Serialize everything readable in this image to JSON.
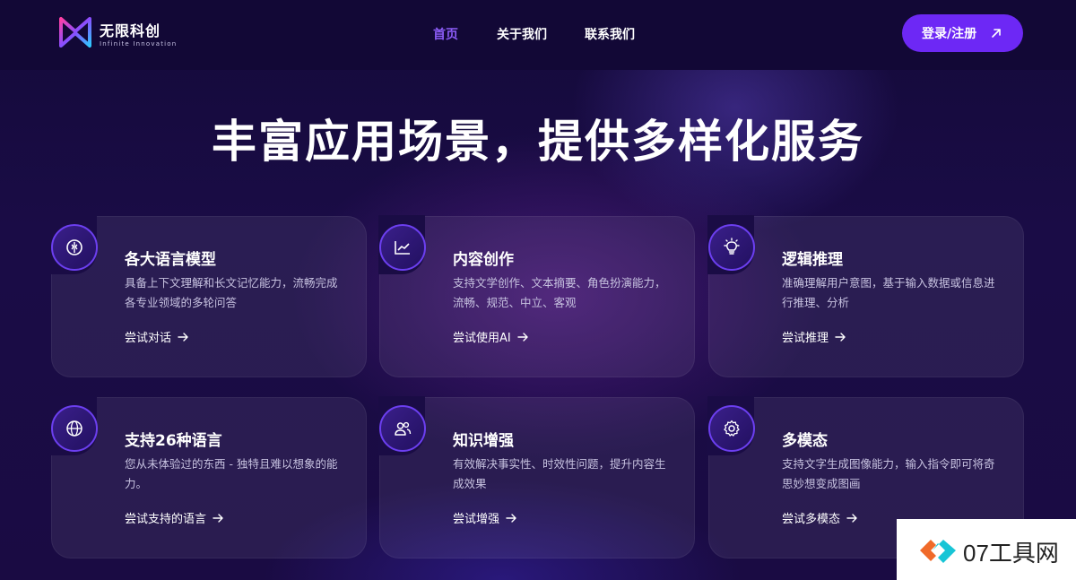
{
  "header": {
    "logo_name": "无限科创",
    "logo_sub": "Infinite Innovation",
    "nav": [
      "首页",
      "关于我们",
      "联系我们"
    ],
    "active_nav": "首页",
    "login_label": "登录/注册"
  },
  "hero": {
    "title": "丰富应用场景，提供多样化服务"
  },
  "cards": [
    {
      "icon": "brain-icon",
      "title": "各大语言模型",
      "desc": "具备上下文理解和长文记忆能力，流畅完成各专业领域的多轮问答",
      "link": "尝试对话"
    },
    {
      "icon": "chart-icon",
      "title": "内容创作",
      "desc": "支持文学创作、文本摘要、角色扮演能力，流畅、规范、中立、客观",
      "link": "尝试使用AI"
    },
    {
      "icon": "lightbulb-icon",
      "title": "逻辑推理",
      "desc": "准确理解用户意图，基于输入数据或信息进行推理、分析",
      "link": "尝试推理"
    },
    {
      "icon": "globe-icon",
      "title": "支持26种语言",
      "desc": "您从未体验过的东西 - 独特且难以想象的能力。",
      "link": "尝试支持的语言"
    },
    {
      "icon": "users-icon",
      "title": "知识增强",
      "desc": "有效解决事实性、时效性问题，提升内容生成效果",
      "link": "尝试增强"
    },
    {
      "icon": "gear-icon",
      "title": "多模态",
      "desc": "支持文字生成图像能力，输入指令即可将奇思妙想变成图画",
      "link": "尝试多模态"
    }
  ],
  "watermark": {
    "text": "07工具网"
  },
  "colors": {
    "accent": "#6d28f5",
    "active_nav": "#8b5cf6",
    "background": "#1a0c45"
  }
}
